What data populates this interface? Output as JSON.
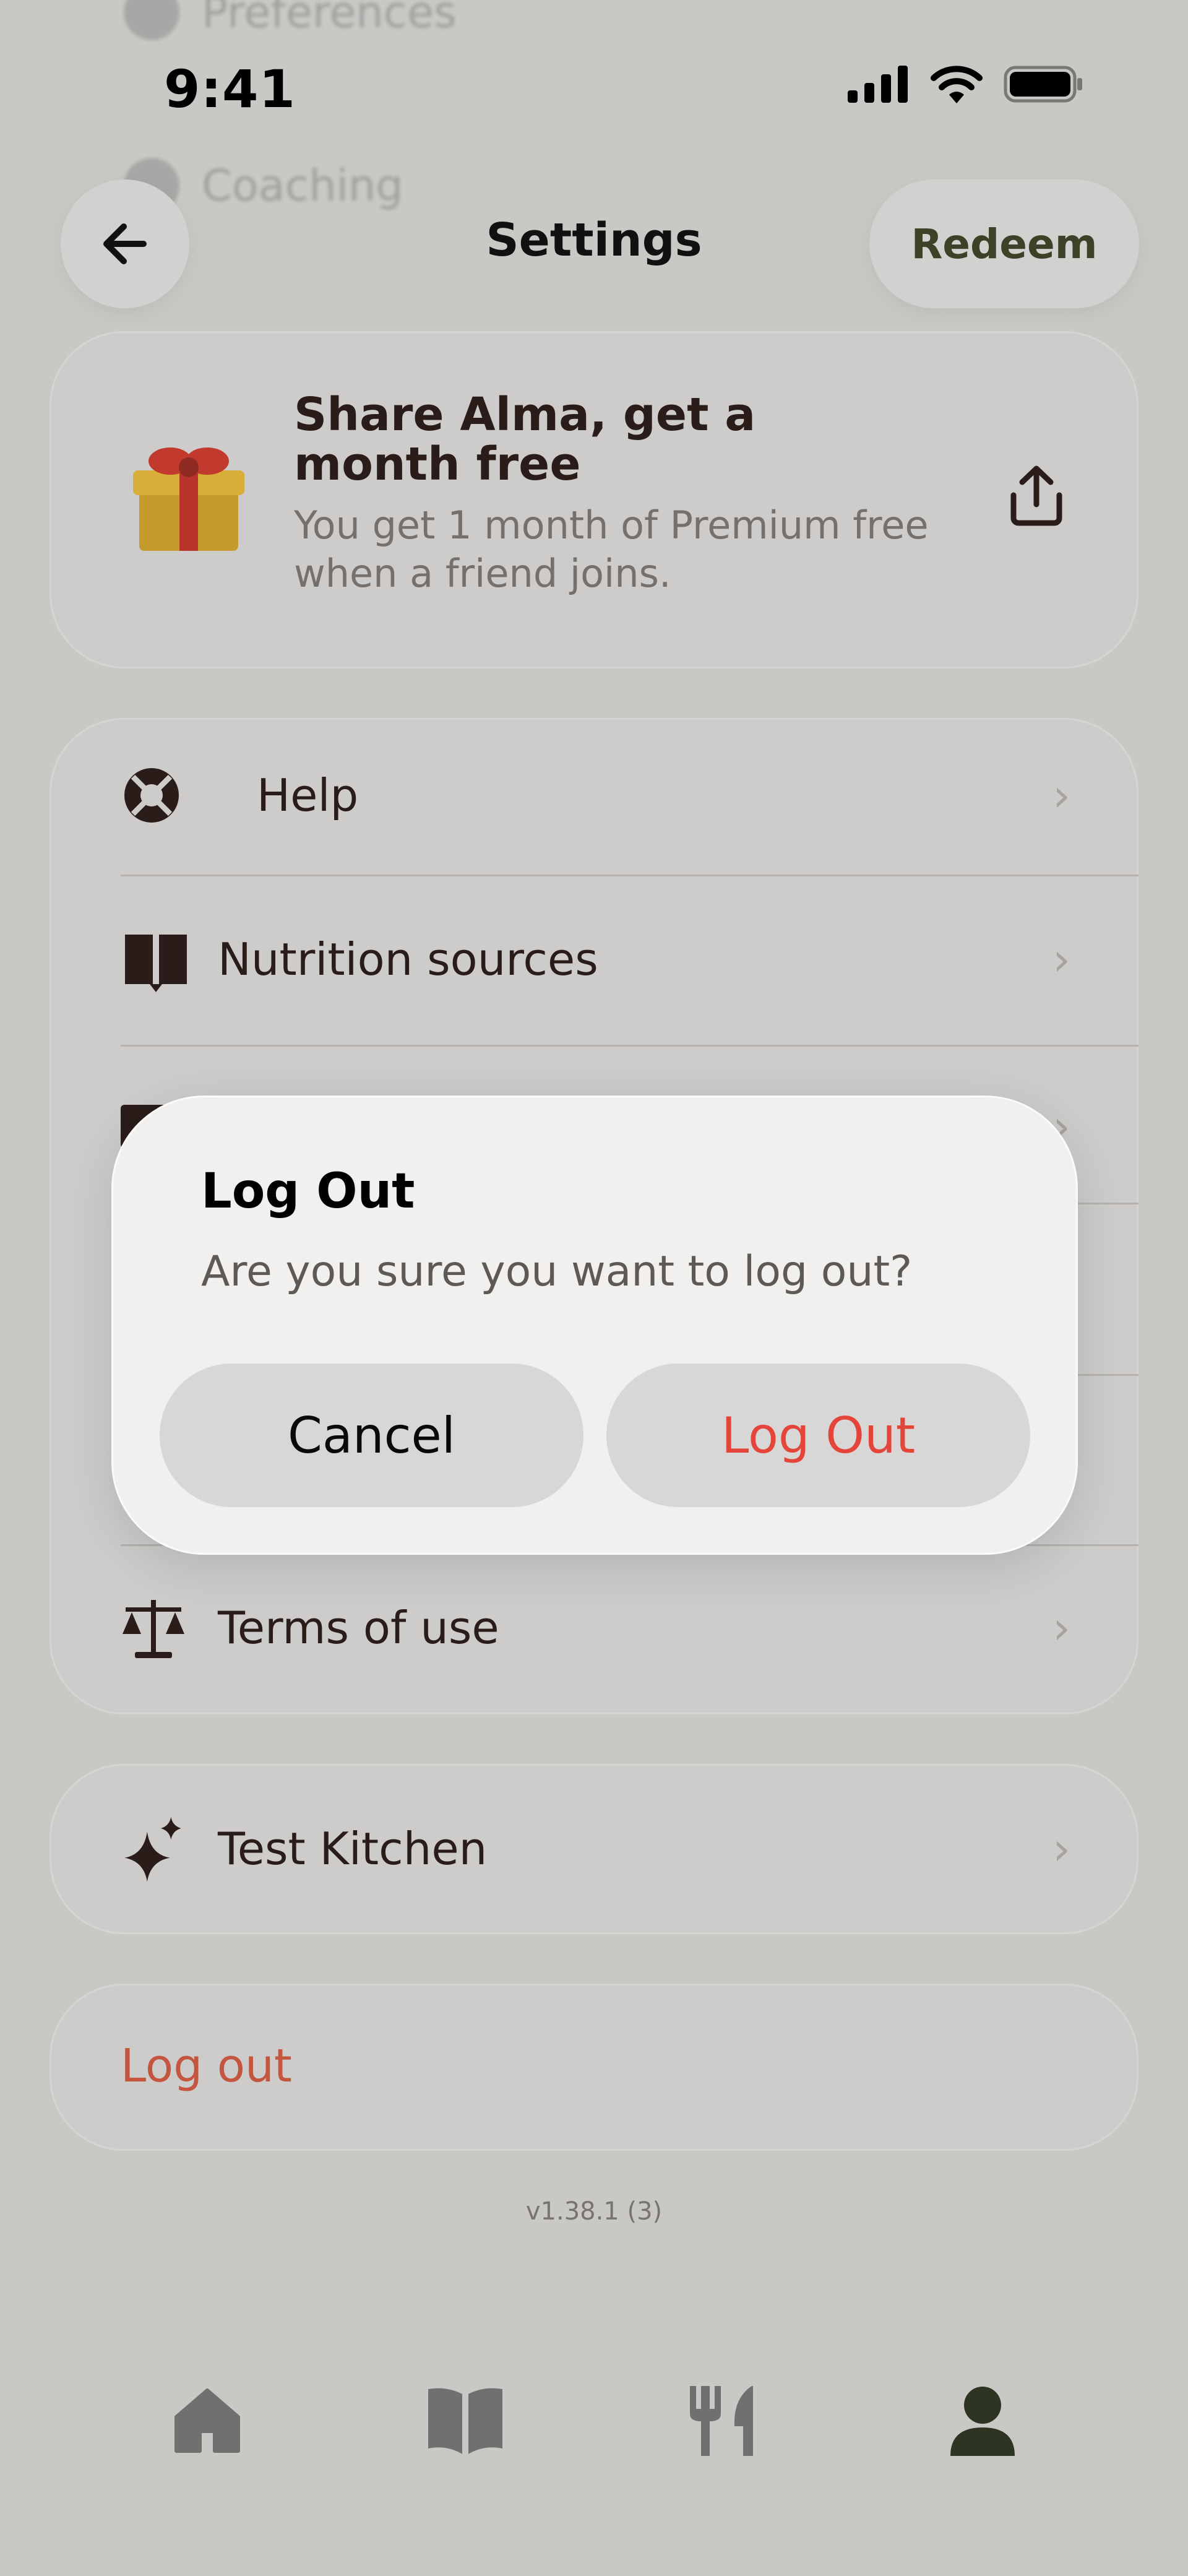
{
  "background_menu": {
    "ghost_items": [
      "Preferences",
      "Coaching"
    ]
  },
  "status_bar": {
    "time": "9:41",
    "icons": [
      "cellular-signal-icon",
      "wifi-icon",
      "battery-icon"
    ]
  },
  "header": {
    "back_icon": "arrow-left-icon",
    "title": "Settings",
    "redeem_label": "Redeem"
  },
  "share": {
    "title": "Share Alma, get a month free",
    "subtitle": "You get 1 month of Premium free when a friend joins.",
    "gift_icon": "gift-icon",
    "share_icon": "share-icon"
  },
  "menu": {
    "items": [
      {
        "label": "Help",
        "icon": "lifebuoy-icon"
      },
      {
        "label": "Nutrition sources",
        "icon": "book-icon"
      },
      {
        "label": "",
        "icon": "envelope-icon"
      },
      {
        "label": "",
        "icon": ""
      },
      {
        "label": "",
        "icon": ""
      },
      {
        "label": "Terms of use",
        "icon": "scales-icon"
      }
    ],
    "chevron": "›"
  },
  "kitchen": {
    "label": "Test Kitchen",
    "icon": "sparkle-icon"
  },
  "logout": {
    "label": "Log out"
  },
  "version": "v1.38.1 (3)",
  "tabbar": {
    "tabs": [
      {
        "name": "home",
        "icon": "home-icon"
      },
      {
        "name": "journal",
        "icon": "book-open-icon"
      },
      {
        "name": "food",
        "icon": "utensils-icon"
      },
      {
        "name": "profile",
        "icon": "person-icon",
        "active": true
      }
    ]
  },
  "dialog": {
    "title": "Log Out",
    "message": "Are you sure you want to log out?",
    "cancel_label": "Cancel",
    "confirm_label": "Log Out"
  },
  "colors": {
    "background": "#c9c8c5",
    "destructive": "#e3453a",
    "logout_text": "#c4553e",
    "active_tab": "#2d3422"
  }
}
